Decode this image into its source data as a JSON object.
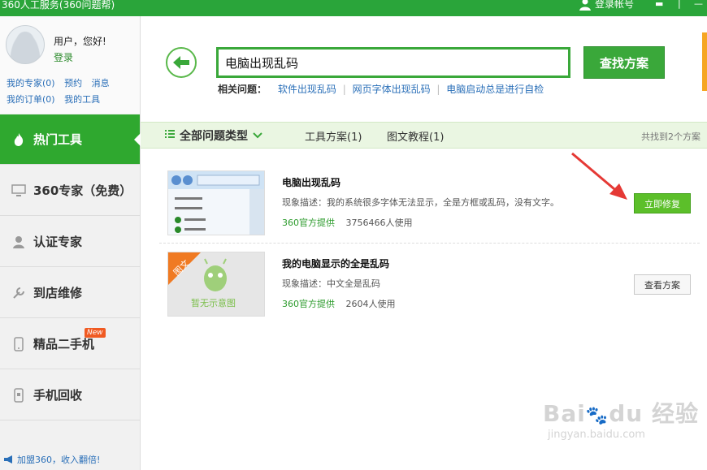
{
  "window": {
    "title": "360人工服务(360问题帮)",
    "login_label": "登录帐号"
  },
  "user": {
    "greeting": "用户，您好!",
    "login_link": "登录",
    "links_row1": [
      "我的专家(0)",
      "预约",
      "消息"
    ],
    "links_row2": [
      "我的订单(0)",
      "我的工具"
    ]
  },
  "nav": [
    {
      "label": "热门工具",
      "icon": "fire-icon",
      "active": true
    },
    {
      "label": "360专家（免费）",
      "icon": "monitor-icon"
    },
    {
      "label": "认证专家",
      "icon": "person-icon"
    },
    {
      "label": "到店维修",
      "icon": "wrench-icon"
    },
    {
      "label": "精品二手机",
      "icon": "phone-icon",
      "badge": "New"
    },
    {
      "label": "手机回收",
      "icon": "recycle-phone-icon"
    }
  ],
  "footer": {
    "join_text": "加盟360，收入翻倍!"
  },
  "search": {
    "value": "电脑出现乱码",
    "button": "查找方案"
  },
  "related": {
    "label": "相关问题：",
    "items": [
      "软件出现乱码",
      "网页字体出现乱码",
      "电脑启动总是进行自检"
    ]
  },
  "filter": {
    "all_types": "全部问题类型",
    "tab_tools": "工具方案(1)",
    "tab_tutorial": "图文教程(1)",
    "count_text": "共找到2个方案"
  },
  "results": [
    {
      "title": "电脑出现乱码",
      "desc": "现象描述：我的系统很多字体无法显示，全是方框或乱码，没有文字。",
      "source": "360官方提供",
      "users": "3756466人使用",
      "button": "立即修复"
    },
    {
      "title": "我的电脑显示的全是乱码",
      "desc": "现象描述：中文全是乱码",
      "source": "360官方提供",
      "users": "2604人使用",
      "button": "查看方案",
      "tag": "图文",
      "placeholder_text": "暂无示意图"
    }
  ],
  "colors": {
    "brand_green": "#2aa53a",
    "accent_arrow": "#e53935"
  }
}
